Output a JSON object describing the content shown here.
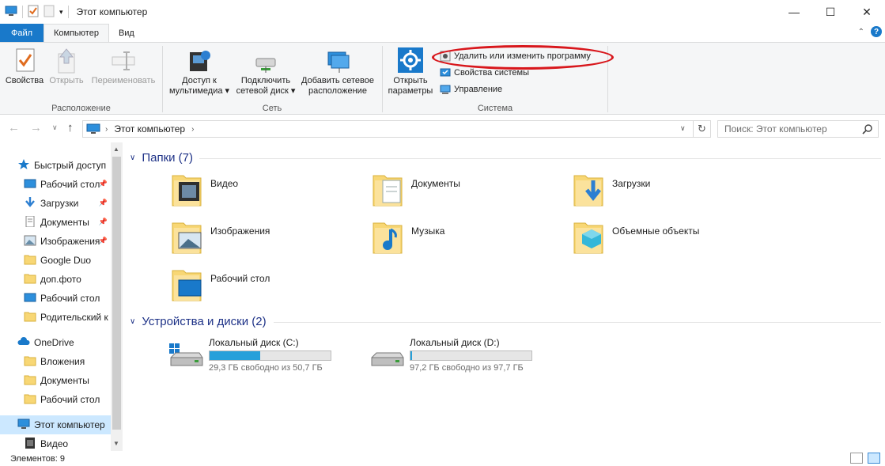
{
  "window": {
    "title": "Этот компьютер",
    "controls": {
      "minimize": "—",
      "maximize": "☐",
      "close": "✕"
    }
  },
  "ribbon_tabs": [
    {
      "label": "Файл"
    },
    {
      "label": "Компьютер"
    },
    {
      "label": "Вид"
    }
  ],
  "ribbon": {
    "location_group": {
      "label": "Расположение",
      "properties": "Свойства",
      "open": "Открыть",
      "rename": "Переименовать"
    },
    "network_group": {
      "label": "Сеть",
      "media_access": [
        "Доступ к",
        "мультимедиа"
      ],
      "map_drive": [
        "Подключить",
        "сетевой диск"
      ],
      "add_location": [
        "Добавить сетевое",
        "расположение"
      ]
    },
    "system_group": {
      "label": "Система",
      "open_settings": [
        "Открыть",
        "параметры"
      ],
      "uninstall": "Удалить или изменить программу",
      "system_props": "Свойства системы",
      "manage": "Управление"
    }
  },
  "address": {
    "path": "Этот компьютер",
    "search_placeholder": "Поиск: Этот компьютер"
  },
  "nav": {
    "items": [
      {
        "label": "Быстрый доступ",
        "icon": "star-icon",
        "pinned": false,
        "selected": false
      },
      {
        "label": "Рабочий стол",
        "icon": "desktop-icon",
        "pinned": true,
        "selected": false
      },
      {
        "label": "Загрузки",
        "icon": "download-icon",
        "pinned": true,
        "selected": false
      },
      {
        "label": "Документы",
        "icon": "document-icon",
        "pinned": true,
        "selected": false
      },
      {
        "label": "Изображения",
        "icon": "pictures-icon",
        "pinned": true,
        "selected": false
      },
      {
        "label": "Google Duo",
        "icon": "folder-icon",
        "pinned": false,
        "selected": false
      },
      {
        "label": "доп.фото",
        "icon": "folder-icon",
        "pinned": false,
        "selected": false
      },
      {
        "label": "Рабочий стол",
        "icon": "desktop-icon",
        "pinned": false,
        "selected": false
      },
      {
        "label": "Родительский к",
        "icon": "folder-icon",
        "pinned": false,
        "selected": false
      },
      {
        "label": "OneDrive",
        "icon": "cloud-icon",
        "pinned": false,
        "selected": false
      },
      {
        "label": "Вложения",
        "icon": "folder-icon",
        "pinned": false,
        "selected": false
      },
      {
        "label": "Документы",
        "icon": "folder-icon",
        "pinned": false,
        "selected": false
      },
      {
        "label": "Рабочий стол",
        "icon": "folder-icon",
        "pinned": false,
        "selected": false
      },
      {
        "label": "Этот компьютер",
        "icon": "computer-icon",
        "pinned": false,
        "selected": true
      },
      {
        "label": "Видео",
        "icon": "video-icon",
        "pinned": false,
        "selected": false
      }
    ]
  },
  "content": {
    "folders_header": "Папки (7)",
    "folders": [
      {
        "label": "Видео",
        "icon": "video-folder-icon"
      },
      {
        "label": "Документы",
        "icon": "documents-folder-icon"
      },
      {
        "label": "Загрузки",
        "icon": "downloads-folder-icon"
      },
      {
        "label": "Изображения",
        "icon": "pictures-folder-icon"
      },
      {
        "label": "Музыка",
        "icon": "music-folder-icon"
      },
      {
        "label": "Объемные объекты",
        "icon": "3d-objects-folder-icon"
      },
      {
        "label": "Рабочий стол",
        "icon": "desktop-folder-icon"
      }
    ],
    "drives_header": "Устройства и диски (2)",
    "drives": [
      {
        "label": "Локальный диск (C:)",
        "free_text": "29,3 ГБ свободно из 50,7 ГБ",
        "used_fraction": 0.42,
        "system": true
      },
      {
        "label": "Локальный диск (D:)",
        "free_text": "97,2 ГБ свободно из 97,7 ГБ",
        "used_fraction": 0.01,
        "system": false
      }
    ]
  },
  "status": {
    "items_count": "Элементов: 9"
  },
  "colors": {
    "accent": "#1979ca",
    "section_header": "#1e3287",
    "drive_bar": "#26a0da",
    "annotation": "#d8171c",
    "selection": "#cce8ff"
  }
}
